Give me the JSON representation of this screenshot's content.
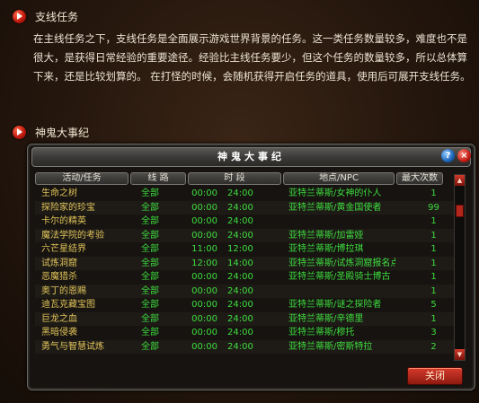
{
  "section1": {
    "title": "支线任务",
    "body": "在主线任务之下，支线任务是全面展示游戏世界背景的任务。这一类任务数量较多，难度也不是很大，是获得日常经验的重要途径。经验比主线任务要少，但这个任务的数量较多，所以总体算下来，还是比较划算的。 在打怪的时候，会随机获得开启任务的道具，使用后可展开支线任务。"
  },
  "section2": {
    "title": "神鬼大事纪"
  },
  "window": {
    "title": "神鬼大事纪",
    "help_label": "?",
    "close_label": "×",
    "close_button": "关闭",
    "columns": [
      "活动/任务",
      "线 路",
      "时 段",
      "地点/NPC",
      "最大次数"
    ],
    "rows": [
      {
        "name": "生命之树",
        "route": "全部",
        "t1": "00:00",
        "t2": "24:00",
        "loc": "亚特兰蒂斯/女神的仆人",
        "count": "1"
      },
      {
        "name": "探险家的珍宝",
        "route": "全部",
        "t1": "00:00",
        "t2": "24:00",
        "loc": "亚特兰蒂斯/黄金国使者",
        "count": "99"
      },
      {
        "name": "卡尔的精英",
        "route": "全部",
        "t1": "00:00",
        "t2": "24:00",
        "loc": "",
        "count": "1"
      },
      {
        "name": "魔法学院的考验",
        "route": "全部",
        "t1": "00:00",
        "t2": "24:00",
        "loc": "亚特兰蒂斯/加雷娅",
        "count": "1"
      },
      {
        "name": "六芒星结界",
        "route": "全部",
        "t1": "11:00",
        "t2": "12:00",
        "loc": "亚特兰蒂斯/博拉琪",
        "count": "1"
      },
      {
        "name": "试炼洞窟",
        "route": "全部",
        "t1": "12:00",
        "t2": "14:00",
        "loc": "亚特兰蒂斯/试炼洞窟报名点",
        "count": "1"
      },
      {
        "name": "恶魔猎杀",
        "route": "全部",
        "t1": "00:00",
        "t2": "24:00",
        "loc": "亚特兰蒂斯/圣殿骑士博古",
        "count": "1"
      },
      {
        "name": "奥丁的恩赐",
        "route": "全部",
        "t1": "00:00",
        "t2": "24:00",
        "loc": "",
        "count": "1"
      },
      {
        "name": "迪瓦克藏宝图",
        "route": "全部",
        "t1": "00:00",
        "t2": "24:00",
        "loc": "亚特兰蒂斯/谜之探险者",
        "count": "5"
      },
      {
        "name": "巨龙之血",
        "route": "全部",
        "t1": "00:00",
        "t2": "24:00",
        "loc": "亚特兰蒂斯/辛德里",
        "count": "1"
      },
      {
        "name": "黑暗侵袭",
        "route": "全部",
        "t1": "00:00",
        "t2": "24:00",
        "loc": "亚特兰蒂斯/穆托",
        "count": "3"
      },
      {
        "name": "勇气与智慧试炼",
        "route": "全部",
        "t1": "00:00",
        "t2": "24:00",
        "loc": "亚特兰蒂斯/密斯特拉",
        "count": "2"
      }
    ],
    "scroll_up": "▲",
    "scroll_down": "▼"
  },
  "colors": {
    "task_name": "#e1c45a",
    "values": "#3edc3e",
    "accent_red": "#c21a0f"
  }
}
